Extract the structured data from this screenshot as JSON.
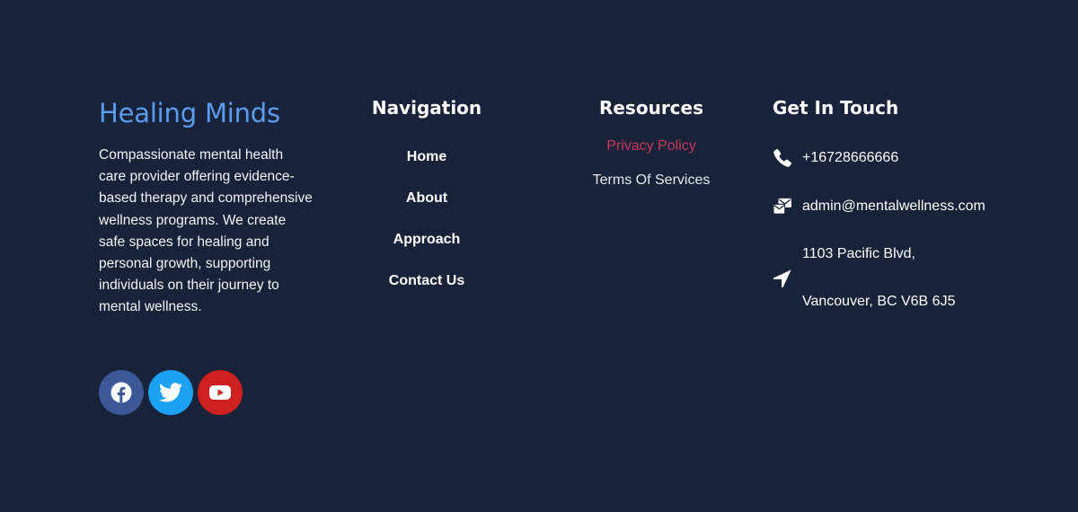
{
  "brand": {
    "title": "Healing Minds",
    "description": "Compassionate mental health care provider offering evidence-based therapy and comprehensive wellness programs. We create safe spaces for healing and personal growth, supporting individuals on their journey to mental wellness."
  },
  "social": [
    {
      "name": "facebook",
      "icon": "facebook-icon",
      "color": "#3b5998"
    },
    {
      "name": "twitter",
      "icon": "twitter-icon",
      "color": "#1da1f2"
    },
    {
      "name": "youtube",
      "icon": "youtube-icon",
      "color": "#cd201f"
    }
  ],
  "navigation": {
    "title": "Navigation",
    "items": [
      "Home",
      "About",
      "Approach",
      "Contact Us"
    ]
  },
  "resources": {
    "title": "Resources",
    "items": [
      {
        "label": "Privacy Policy",
        "color": "#c8375e"
      },
      {
        "label": "Terms Of Services",
        "color": "#e6e9ef"
      }
    ]
  },
  "contact": {
    "title": "Get In Touch",
    "phone": "+16728666666",
    "email": "admin@mentalwellness.com",
    "address_line1": "1103 Pacific Blvd,",
    "address_line2": "Vancouver, BC V6B 6J5"
  },
  "colors": {
    "background": "#18233a",
    "brand_accent": "#5b9cf0"
  }
}
